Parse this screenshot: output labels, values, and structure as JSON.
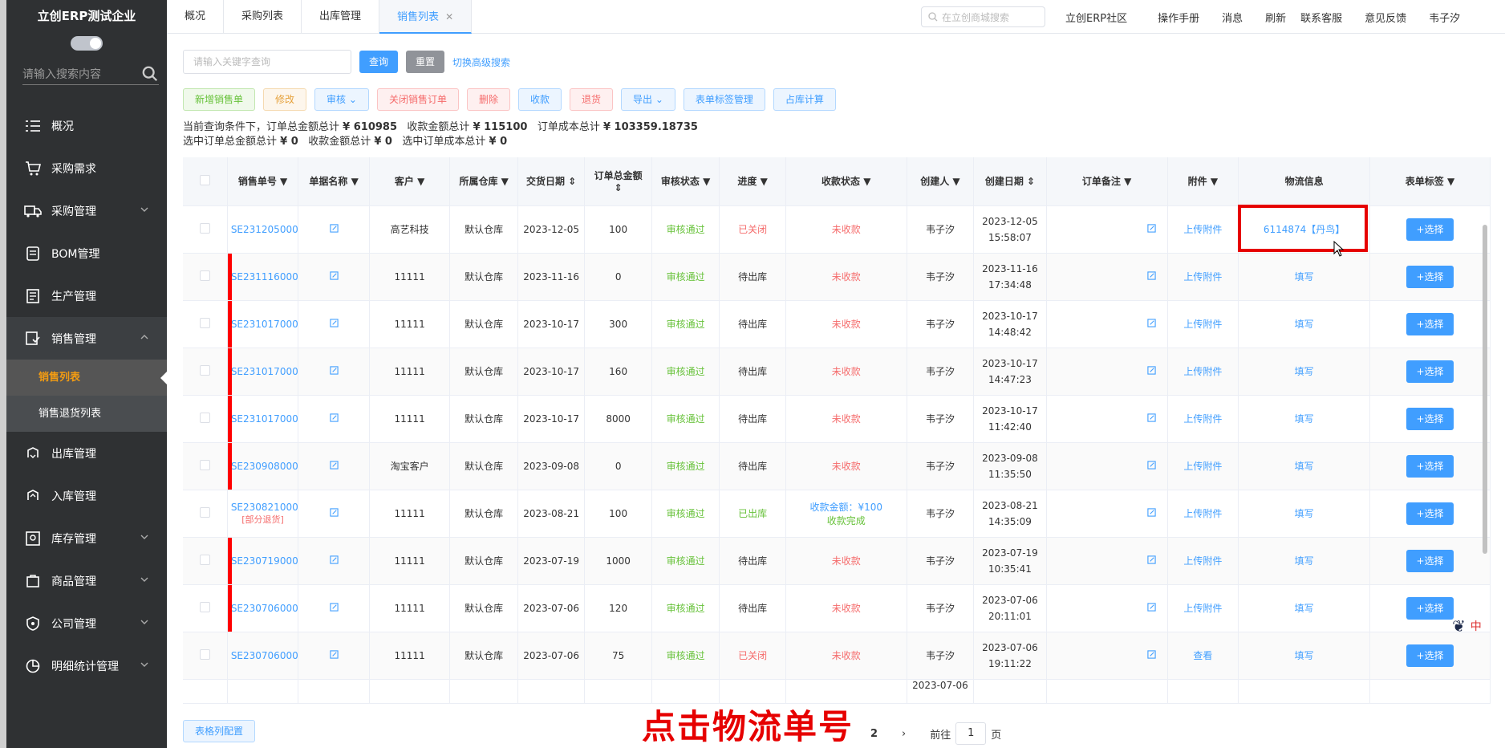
{
  "sidebar": {
    "company": "立创ERP测试企业",
    "search_placeholder": "请输入搜索内容",
    "menu": [
      {
        "label": "概况",
        "icon": "list-icon"
      },
      {
        "label": "采购需求",
        "icon": "cart-icon"
      },
      {
        "label": "采购管理",
        "icon": "truck-icon"
      },
      {
        "label": "BOM管理",
        "icon": "layers-icon"
      },
      {
        "label": "生产管理",
        "icon": "document-icon"
      },
      {
        "label": "销售管理",
        "icon": "sales-icon"
      },
      {
        "label": "出库管理",
        "icon": "outbox-icon"
      },
      {
        "label": "入库管理",
        "icon": "inbox-icon"
      },
      {
        "label": "库存管理",
        "icon": "warehouse-icon"
      },
      {
        "label": "商品管理",
        "icon": "goods-icon"
      },
      {
        "label": "公司管理",
        "icon": "shield-icon"
      },
      {
        "label": "明细统计管理",
        "icon": "pie-chart-icon"
      }
    ],
    "submenu": [
      "销售列表",
      "销售退货列表"
    ]
  },
  "topbar": {
    "tabs": [
      "概况",
      "采购列表",
      "出库管理",
      "销售列表"
    ],
    "search_placeholder": "在立创商城搜索",
    "links": [
      "立创ERP社区",
      "操作手册",
      "消息",
      "刷新",
      "联系客服",
      "意见反馈",
      "韦子汐"
    ]
  },
  "filter": {
    "keyword_placeholder": "请输入关键字查询",
    "query": "查询",
    "reset": "重置",
    "advanced": "切换高级搜索"
  },
  "actions": [
    "新增销售单",
    "修改",
    "审核",
    "关闭销售订单",
    "删除",
    "收款",
    "退货",
    "导出",
    "表单标签管理",
    "占库计算"
  ],
  "summary": {
    "line1_prefix": "当前查询条件下，订单总金额总计",
    "order_total": "¥ 610985",
    "received_label": "收款金额总计",
    "received_total": "¥ 115100",
    "cost_label": "订单成本总计",
    "cost_total": "¥ 103359.18735",
    "line2_prefix": "选中订单总金额总计",
    "sel_order": "¥ 0",
    "sel_received_label": "收款金额总计",
    "sel_received": "¥ 0",
    "sel_cost_label": "选中订单成本总计",
    "sel_cost": "¥ 0"
  },
  "table": {
    "headers": [
      "销售单号",
      "单据名称",
      "客户",
      "所属仓库",
      "交货日期",
      "订单总金额",
      "审核状态",
      "进度",
      "收款状态",
      "创建人",
      "创建日期",
      "订单备注",
      "附件",
      "物流信息",
      "表单标签"
    ],
    "rows": [
      {
        "no": "SE231205000",
        "customer": "高艺科技",
        "warehouse": "默认仓库",
        "delivery": "2023-12-05",
        "amount": "100",
        "audit": "审核通过",
        "progress": "已关闭",
        "payment": "未收款",
        "creator": "韦子汐",
        "date": "2023-12-05",
        "time": "15:58:07",
        "attach": "上传附件",
        "logistics": "6114874【丹鸟】",
        "tag": "+选择"
      },
      {
        "no": "SE231116000",
        "customer": "11111",
        "warehouse": "默认仓库",
        "delivery": "2023-11-16",
        "amount": "0",
        "audit": "审核通过",
        "progress": "待出库",
        "payment": "未收款",
        "creator": "韦子汐",
        "date": "2023-11-16",
        "time": "17:34:48",
        "attach": "上传附件",
        "logistics": "填写",
        "tag": "+选择"
      },
      {
        "no": "SE231017000",
        "customer": "11111",
        "warehouse": "默认仓库",
        "delivery": "2023-10-17",
        "amount": "300",
        "audit": "审核通过",
        "progress": "待出库",
        "payment": "未收款",
        "creator": "韦子汐",
        "date": "2023-10-17",
        "time": "14:48:42",
        "attach": "上传附件",
        "logistics": "填写",
        "tag": "+选择"
      },
      {
        "no": "SE231017000",
        "customer": "11111",
        "warehouse": "默认仓库",
        "delivery": "2023-10-17",
        "amount": "160",
        "audit": "审核通过",
        "progress": "待出库",
        "payment": "未收款",
        "creator": "韦子汐",
        "date": "2023-10-17",
        "time": "14:47:23",
        "attach": "上传附件",
        "logistics": "填写",
        "tag": "+选择"
      },
      {
        "no": "SE231017000",
        "customer": "11111",
        "warehouse": "默认仓库",
        "delivery": "2023-10-17",
        "amount": "8000",
        "audit": "审核通过",
        "progress": "待出库",
        "payment": "未收款",
        "creator": "韦子汐",
        "date": "2023-10-17",
        "time": "11:42:40",
        "attach": "上传附件",
        "logistics": "填写",
        "tag": "+选择"
      },
      {
        "no": "SE230908000",
        "customer": "淘宝客户",
        "warehouse": "默认仓库",
        "delivery": "2023-09-08",
        "amount": "0",
        "audit": "审核通过",
        "progress": "待出库",
        "payment": "未收款",
        "creator": "韦子汐",
        "date": "2023-09-08",
        "time": "11:35:50",
        "attach": "上传附件",
        "logistics": "填写",
        "tag": "+选择"
      },
      {
        "no": "SE230821000",
        "note": "[部分退货]",
        "customer": "11111",
        "warehouse": "默认仓库",
        "delivery": "2023-08-21",
        "amount": "100",
        "audit": "审核通过",
        "progress": "已出库",
        "payment": "收款金额：¥100",
        "payment2": "收款完成",
        "creator": "韦子汐",
        "date": "2023-08-21",
        "time": "14:35:09",
        "attach": "上传附件",
        "logistics": "填写",
        "tag": "+选择"
      },
      {
        "no": "SE230719000",
        "customer": "11111",
        "warehouse": "默认仓库",
        "delivery": "2023-07-19",
        "amount": "1000",
        "audit": "审核通过",
        "progress": "待出库",
        "payment": "未收款",
        "creator": "韦子汐",
        "date": "2023-07-19",
        "time": "10:35:41",
        "attach": "上传附件",
        "logistics": "填写",
        "tag": "+选择"
      },
      {
        "no": "SE230706000",
        "customer": "11111",
        "warehouse": "默认仓库",
        "delivery": "2023-07-06",
        "amount": "120",
        "audit": "审核通过",
        "progress": "待出库",
        "payment": "未收款",
        "creator": "韦子汐",
        "date": "2023-07-06",
        "time": "20:11:01",
        "attach": "上传附件",
        "logistics": "填写",
        "tag": "+选择"
      },
      {
        "no": "SE230706000",
        "customer": "11111",
        "warehouse": "默认仓库",
        "delivery": "2023-07-06",
        "amount": "75",
        "audit": "审核通过",
        "progress": "已关闭",
        "payment": "未收款",
        "creator": "韦子汐",
        "date": "2023-07-06",
        "time": "19:11:22",
        "attach": "查看",
        "logistics": "填写",
        "tag": "+选择"
      }
    ],
    "partial_date": "2023-07-06"
  },
  "footer": {
    "config": "表格列配置",
    "overlay": "点击物流单号",
    "page_next": "2",
    "goto": "前往",
    "page_input": "1",
    "page_unit": "页"
  },
  "float_badge": "中"
}
